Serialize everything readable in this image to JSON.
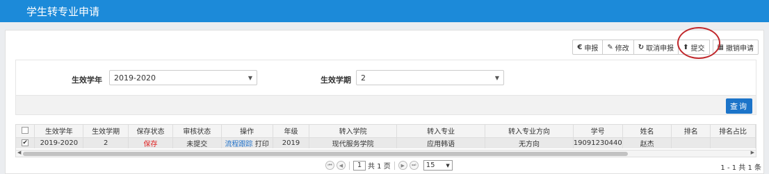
{
  "header": {
    "title": "学生转专业申请"
  },
  "toolbar": {
    "buttons": [
      {
        "icon": "€",
        "label": "申报"
      },
      {
        "icon": "✎",
        "label": "修改"
      },
      {
        "icon": "↻",
        "label": "取消申报"
      },
      {
        "icon": "⬆",
        "label": "提交"
      },
      {
        "icon": "▦",
        "label": "撤销申请"
      }
    ]
  },
  "filter": {
    "year_label": "生效学年",
    "year_value": "2019-2020",
    "term_label": "生效学期",
    "term_value": "2",
    "query_label": "查询"
  },
  "table": {
    "headers": [
      "生效学年",
      "生效学期",
      "保存状态",
      "审核状态",
      "操作",
      "年级",
      "转入学院",
      "转入专业",
      "转入专业方向",
      "学号",
      "姓名",
      "排名",
      "排名占比"
    ],
    "rows": [
      {
        "checked": "✔",
        "year": "2019-2020",
        "term": "2",
        "save_status": "保存",
        "audit_status": "未提交",
        "op_track": "流程跟踪",
        "op_print": "打印",
        "grade": "2019",
        "college": "现代服务学院",
        "major": "应用韩语",
        "direction": "无方向",
        "student_id": "19091230440",
        "name": "赵杰",
        "rank": "",
        "rank_ratio": ""
      }
    ]
  },
  "pager": {
    "current_page": "1",
    "total_pages_text": "共 1 页",
    "page_size": "15",
    "record_text": "1 - 1   共 1 条"
  }
}
